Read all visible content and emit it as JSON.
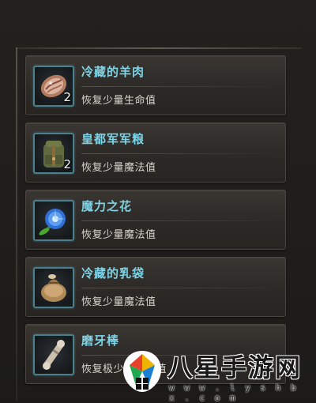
{
  "inventory": {
    "items": [
      {
        "name": "冷藏的羊肉",
        "desc": "恢复少量生命值",
        "count": "2",
        "icon": "meat-icon"
      },
      {
        "name": "皇都军军粮",
        "desc": "恢复少量魔法值",
        "count": "2",
        "icon": "backpack-icon"
      },
      {
        "name": "魔力之花",
        "desc": "恢复少量魔法值",
        "count": "",
        "icon": "blue-flower-icon"
      },
      {
        "name": "冷藏的乳袋",
        "desc": "恢复少量魔法值",
        "count": "",
        "icon": "milk-pouch-icon"
      },
      {
        "name": "磨牙棒",
        "desc": "恢复极少量魔法值",
        "count": "",
        "icon": "bone-stick-icon"
      }
    ]
  },
  "colors": {
    "item_name": "#7fd3e6",
    "icon_border": "#4c7f8c"
  },
  "watermark": {
    "title": "八星手游网",
    "url": "w w w . l y s h b x . c o m"
  }
}
